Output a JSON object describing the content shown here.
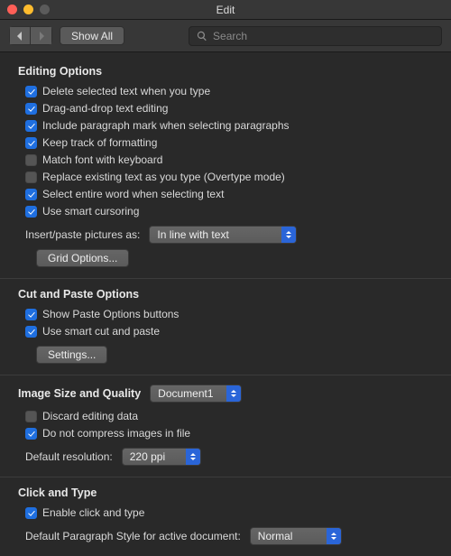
{
  "window": {
    "title": "Edit"
  },
  "toolbar": {
    "show_all": "Show All",
    "search_placeholder": "Search"
  },
  "sections": {
    "editing": {
      "title": "Editing Options",
      "options": [
        {
          "label": "Delete selected text when you type",
          "checked": true
        },
        {
          "label": "Drag-and-drop text editing",
          "checked": true
        },
        {
          "label": "Include paragraph mark when selecting paragraphs",
          "checked": true
        },
        {
          "label": "Keep track of formatting",
          "checked": true
        },
        {
          "label": "Match font with keyboard",
          "checked": false
        },
        {
          "label": "Replace existing text as you type (Overtype mode)",
          "checked": false
        },
        {
          "label": "Select entire word when selecting text",
          "checked": true
        },
        {
          "label": "Use smart cursoring",
          "checked": true
        }
      ],
      "insert_label": "Insert/paste pictures as:",
      "insert_value": "In line with text",
      "grid_btn": "Grid Options..."
    },
    "cutpaste": {
      "title": "Cut and Paste Options",
      "options": [
        {
          "label": "Show Paste Options buttons",
          "checked": true
        },
        {
          "label": "Use smart cut and paste",
          "checked": true
        }
      ],
      "settings_btn": "Settings..."
    },
    "image": {
      "title": "Image Size and Quality",
      "doc_value": "Document1",
      "options": [
        {
          "label": "Discard editing data",
          "checked": false
        },
        {
          "label": "Do not compress images in file",
          "checked": true
        }
      ],
      "res_label": "Default resolution:",
      "res_value": "220 ppi"
    },
    "clicktype": {
      "title": "Click and Type",
      "enable": {
        "label": "Enable click and type",
        "checked": true
      },
      "style_label": "Default Paragraph Style for active document:",
      "style_value": "Normal"
    }
  }
}
